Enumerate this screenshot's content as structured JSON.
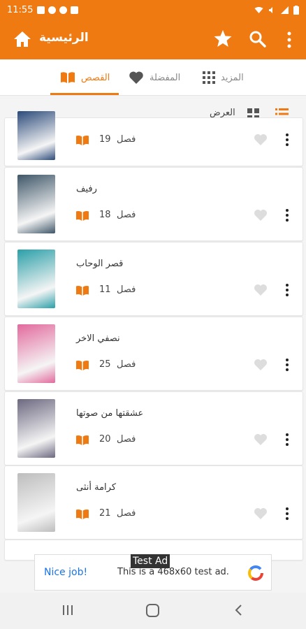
{
  "status_bar": {
    "time": "11:55"
  },
  "app_bar": {
    "title": "الرئيسية"
  },
  "tabs": [
    {
      "label": "القصص",
      "icon": "book-icon",
      "active": true
    },
    {
      "label": "المفضلة",
      "icon": "heart-icon",
      "active": false
    },
    {
      "label": "المزيد",
      "icon": "grid-icon",
      "active": false
    }
  ],
  "view": {
    "label": "العرض"
  },
  "stories": [
    {
      "title": "",
      "chapter_number": "19",
      "chapter_word": "فصل",
      "cover_color": "#2b4a7a"
    },
    {
      "title": "رفيف",
      "chapter_number": "18",
      "chapter_word": "فصل",
      "cover_color": "#3e5668"
    },
    {
      "title": "قصر الوحاب",
      "chapter_number": "11",
      "chapter_word": "فصل",
      "cover_color": "#2a9fa8"
    },
    {
      "title": "نصفي الاخر",
      "chapter_number": "25",
      "chapter_word": "فصل",
      "cover_color": "#e26a9d"
    },
    {
      "title": "عشقتها من صوتها",
      "chapter_number": "20",
      "chapter_word": "فصل",
      "cover_color": "#6c6880"
    },
    {
      "title": "كرامة أنثى",
      "chapter_number": "21",
      "chapter_word": "فصل",
      "cover_color": "#bdbdbd"
    }
  ],
  "ad": {
    "tag": "Test Ad",
    "nice": "Nice job!",
    "text": "This is a 468x60 test ad."
  },
  "colors": {
    "accent": "#f07a12",
    "heart": "#dddddd"
  }
}
